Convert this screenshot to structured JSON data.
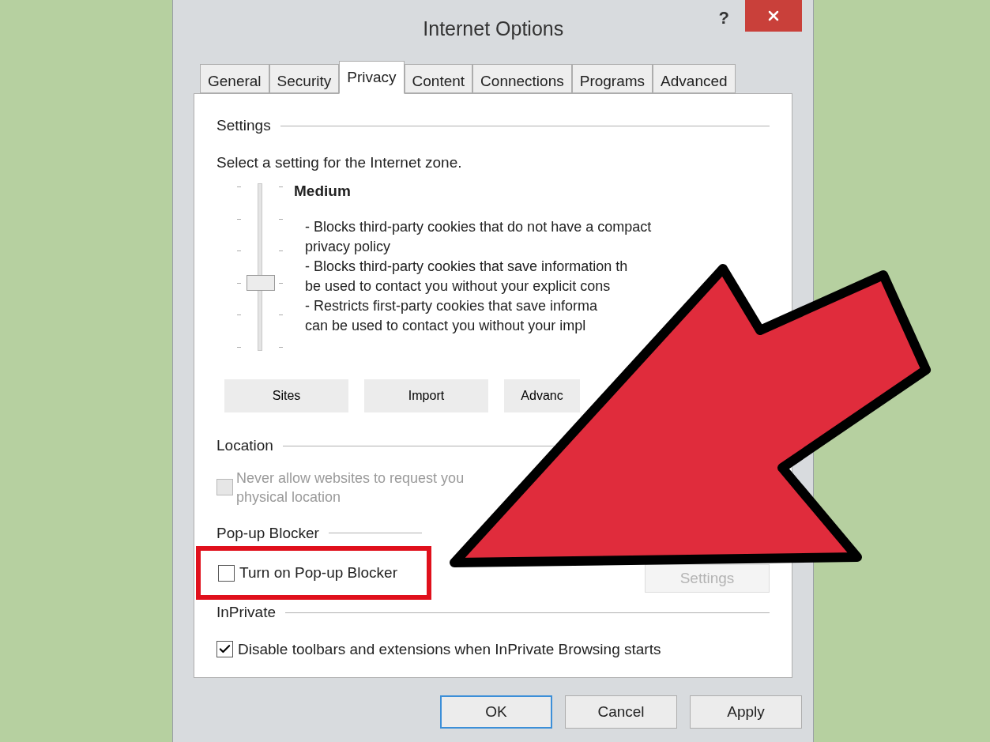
{
  "window": {
    "title": "Internet Options",
    "help": "?"
  },
  "tabs": [
    {
      "label": "General",
      "selected": false
    },
    {
      "label": "Security",
      "selected": false
    },
    {
      "label": "Privacy",
      "selected": true
    },
    {
      "label": "Content",
      "selected": false
    },
    {
      "label": "Connections",
      "selected": false
    },
    {
      "label": "Programs",
      "selected": false
    },
    {
      "label": "Advanced",
      "selected": false
    }
  ],
  "settings": {
    "heading": "Settings",
    "prompt": "Select a setting for the Internet zone.",
    "slider": {
      "level": 0.4
    },
    "level_name": "Medium",
    "description": [
      "- Blocks third-party cookies that do not have a compact",
      "privacy policy",
      "- Blocks third-party cookies that save information th",
      "be used to contact you without your explicit cons",
      "- Restricts first-party cookies that save informa",
      "can be used to contact you without your impl"
    ],
    "buttons": [
      "Sites",
      "Import",
      "Advanc"
    ]
  },
  "location": {
    "heading": "Location",
    "checkbox": {
      "label": [
        "Never allow websites to request you",
        "physical location"
      ],
      "checked": false,
      "disabled": true
    }
  },
  "popup_blocker": {
    "heading": "Pop-up Blocker",
    "checkbox": {
      "label": "Turn on Pop-up Blocker",
      "checked": false
    },
    "settings_button": {
      "label": "Settings",
      "disabled": true
    }
  },
  "inprivate": {
    "heading": "InPrivate",
    "checkbox": {
      "label": "Disable toolbars and extensions when InPrivate Browsing starts",
      "checked": true
    }
  },
  "footer_buttons": [
    {
      "label": "OK",
      "default": true
    },
    {
      "label": "Cancel",
      "default": false
    },
    {
      "label": "Apply",
      "default": false
    }
  ]
}
